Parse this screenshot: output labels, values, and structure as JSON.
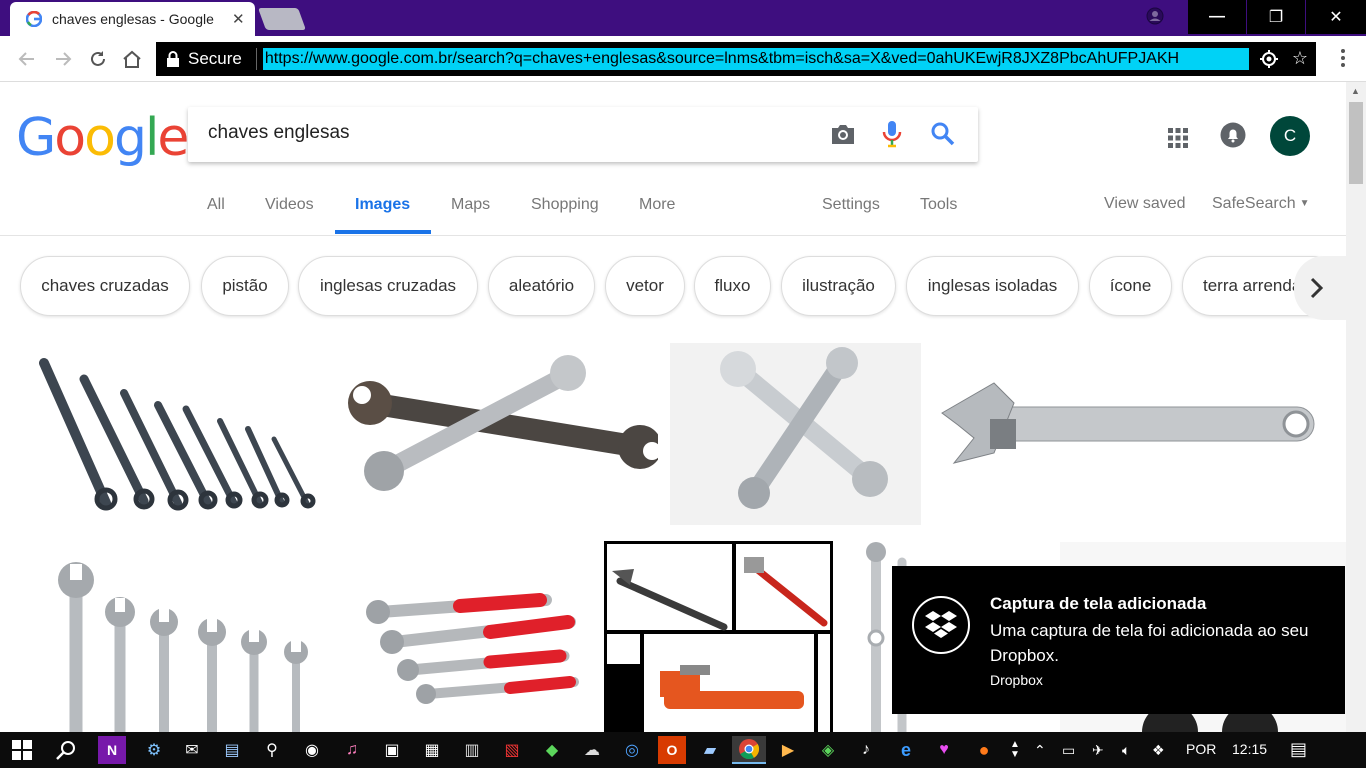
{
  "browser": {
    "tab_title": "chaves englesas - Google",
    "secure_label": "Secure",
    "url": "https://www.google.com.br/search?q=chaves+englesas&source=lnms&tbm=isch&sa=X&ved=0ahUKEwjR8JXZ8PbcAhUFPJAKH",
    "window_buttons": {
      "minimize": "—",
      "restore": "❐",
      "close": "✕"
    }
  },
  "google": {
    "logo": [
      "G",
      "o",
      "o",
      "g",
      "l",
      "e"
    ],
    "logo_colors": [
      "#4285F4",
      "#EA4335",
      "#FBBC05",
      "#4285F4",
      "#34A853",
      "#EA4335"
    ],
    "query": "chaves englesas",
    "avatar_letter": "C",
    "nav": {
      "all": "All",
      "videos": "Videos",
      "images": "Images",
      "maps": "Maps",
      "shopping": "Shopping",
      "more": "More",
      "settings": "Settings",
      "tools": "Tools",
      "view_saved": "View saved",
      "safesearch": "SafeSearch"
    },
    "chips": [
      "chaves cruzadas",
      "pistão",
      "inglesas cruzadas",
      "aleatório",
      "vetor",
      "fluxo",
      "ilustração",
      "inglesas isoladas",
      "ícone",
      "terra arrendada"
    ]
  },
  "toast": {
    "title": "Captura de tela adicionada",
    "body": "Uma captura de tela foi adicionada ao seu Dropbox.",
    "app": "Dropbox"
  },
  "taskbar": {
    "language": "POR",
    "time": "12:15"
  },
  "colors": {
    "titlebar": "#3e0e7f",
    "url_highlight": "#00d2f6",
    "accent": "#1a73e8",
    "avatar": "#00473a"
  }
}
